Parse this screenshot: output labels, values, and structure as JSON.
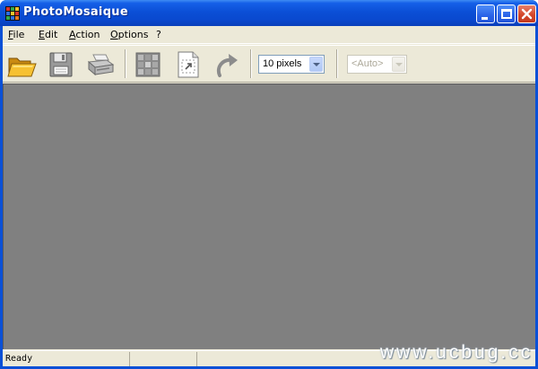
{
  "window": {
    "title": "PhotoMosaique"
  },
  "menu": {
    "items": [
      {
        "accel": "F",
        "rest": "ile"
      },
      {
        "accel": "E",
        "rest": "dit"
      },
      {
        "accel": "A",
        "rest": "ction"
      },
      {
        "accel": "O",
        "rest": "ptions"
      },
      {
        "accel": "",
        "rest": "?"
      }
    ]
  },
  "toolbar": {
    "buttons": [
      {
        "icon": "open-folder-icon"
      },
      {
        "icon": "save-disk-icon"
      },
      {
        "icon": "print-icon"
      },
      {
        "icon": "mosaic-grid-icon"
      },
      {
        "icon": "page-resize-icon"
      },
      {
        "icon": "undo-arrow-icon"
      }
    ],
    "tile_size": {
      "value": "10 pixels"
    },
    "auto_select": {
      "value": "<Auto>"
    }
  },
  "status": {
    "text": "Ready"
  },
  "watermark": {
    "text": "www.ucbug.cc"
  }
}
